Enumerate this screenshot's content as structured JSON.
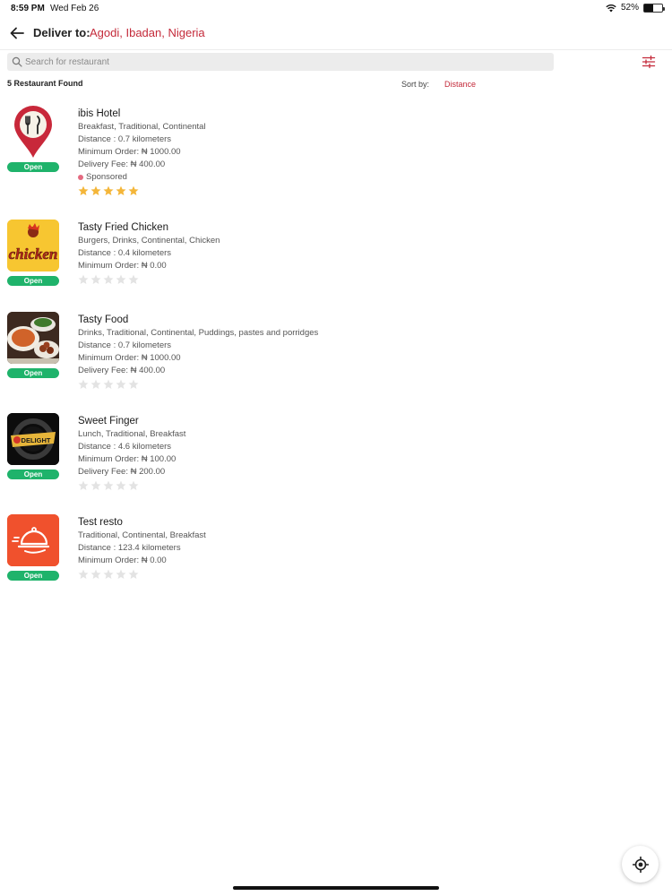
{
  "status_bar": {
    "time": "8:59 PM",
    "date": "Wed Feb 26",
    "battery_text": "52%",
    "battery_level": 0.52,
    "wifi_icon": "wifi-icon"
  },
  "header": {
    "back_icon": "arrow-left-icon",
    "deliver_label": "Deliver to:",
    "location": "Agodi, Ibadan, Nigeria"
  },
  "search": {
    "placeholder": "Search for restaurant",
    "value": ""
  },
  "filter_icon": "sliders-icon",
  "results": {
    "count_text": "5 Restaurant Found",
    "sort_label": "Sort by:",
    "sort_value": "Distance"
  },
  "restaurants": [
    {
      "name": "ibis Hotel",
      "status": "Open",
      "categories": "Breakfast, Traditional, Continental",
      "distance": "Distance : 0.7 kilometers",
      "min_order": "Minimum Order: ₦ 1000.00",
      "delivery_fee": "Delivery Fee: ₦ 400.00",
      "sponsored": "Sponsored",
      "rating": 5,
      "logo": "map-pin-fork-knife-logo"
    },
    {
      "name": "Tasty Fried Chicken",
      "status": "Open",
      "categories": "Burgers, Drinks, Continental, Chicken",
      "distance": "Distance : 0.4 kilometers",
      "min_order": "Minimum Order: ₦ 0.00",
      "rating": 0,
      "logo": "chicken-logo",
      "logo_text": "chicken"
    },
    {
      "name": "Tasty Food",
      "status": "Open",
      "categories": "Drinks, Traditional, Continental, Puddings, pastes and porridges",
      "distance": "Distance : 0.7 kilometers",
      "min_order": "Minimum Order: ₦ 1000.00",
      "delivery_fee": "Delivery Fee: ₦ 400.00",
      "rating": 0,
      "logo": "food-photo"
    },
    {
      "name": "Sweet Finger",
      "status": "Open",
      "categories": "Lunch, Traditional, Breakfast",
      "distance": "Distance : 4.6 kilometers",
      "min_order": "Minimum Order: ₦ 100.00",
      "delivery_fee": "Delivery Fee: ₦ 200.00",
      "rating": 0,
      "logo": "delight-badge-logo",
      "logo_text": "DELIGHT"
    },
    {
      "name": "Test resto",
      "status": "Open",
      "categories": "Traditional, Continental, Breakfast",
      "distance": "Distance : 123.4 kilometers",
      "min_order": "Minimum Order: ₦ 0.00",
      "rating": 0,
      "logo": "cloche-delivery-logo"
    }
  ],
  "locate_icon": "crosshair-icon",
  "colors": {
    "accent": "#c42a3a",
    "open_badge": "#1fb36b",
    "star_filled": "#f4b63a",
    "star_empty": "#e3e3e3"
  }
}
